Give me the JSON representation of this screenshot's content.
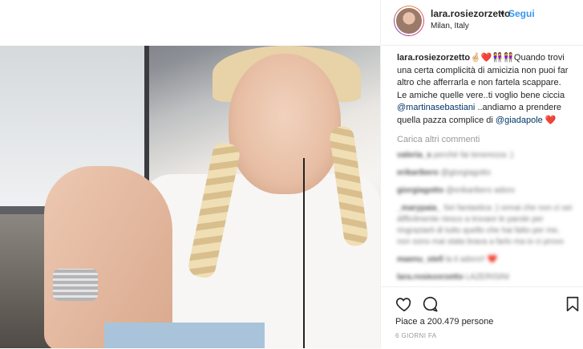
{
  "post": {
    "username": "lara.rosiezorzetto",
    "separator": "•",
    "follow_label": "Segui",
    "location": "Milan, Italy"
  },
  "caption": {
    "username": "lara.rosiezorzetto",
    "emoji": "🤞🏻❤️👭👭",
    "text_1": "Quando trovi una certa complicità di amicizia non puoi far altro che afferrarla e non fartela scappare. Le amiche quelle vere..ti voglio bene ciccia ",
    "mention_1": "@martinasebastiani",
    "text_2": " ..andiamo a prendere quella pazza complice di ",
    "mention_2": "@giadapole",
    "text_3": " ❤️"
  },
  "load_more_label": "Carica altri commenti",
  "blurred_comments": [
    {
      "user": "valeria_s",
      "text": "perchè fai tenerezza :)"
    },
    {
      "user": "erikaribero",
      "text": "@giorgiagotto"
    },
    {
      "user": "giorgiagotto",
      "text": "@erikaribero adoro"
    },
    {
      "user": "_marypaia_",
      "text": "Sei fantastica :) ormai che non ci sei difficilmente riesco a trovare le parole per ringraziarti di tutto quello che hai fatto per me, non sono mai stata brava a farlo ma io ci provo"
    },
    {
      "user": "maenu_stell",
      "text": "la ti adoro!! ❤️"
    },
    {
      "user": "lara.rosiezorzetto",
      "text": "LAZERISINI"
    }
  ],
  "likes_label": "Piace a 200.479 persone",
  "time_label": "6 GIORNI FA",
  "icons": [
    "heart-icon",
    "comment-icon",
    "bookmark-icon"
  ]
}
